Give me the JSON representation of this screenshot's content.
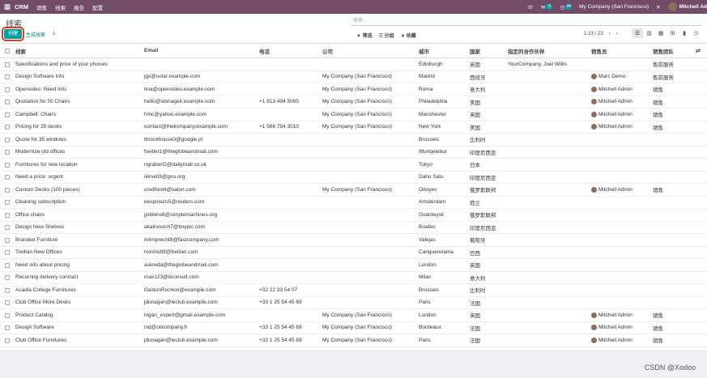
{
  "topbar": {
    "app": "CRM",
    "menus": [
      "销售",
      "线索",
      "报告",
      "配置"
    ],
    "msg_count": "5",
    "activity_count": "44",
    "company": "My Company (San Francisco)",
    "user": "Mitchell Ad"
  },
  "control": {
    "title": "线索",
    "search_placeholder": "搜索...",
    "create_label": "创建",
    "generate_label": "生成线索",
    "filter_label": "筛选",
    "group_label": "分组",
    "favorite_label": "收藏",
    "pager": "1-23 / 23"
  },
  "columns": [
    "线索",
    "Email",
    "电话",
    "公司",
    "城市",
    "国家",
    "指定的合作伙伴",
    "销售员",
    "销售团队"
  ],
  "rows": [
    [
      "Specifications and price of your phones",
      "",
      "",
      "",
      "Edinburgh",
      "英国",
      "YourCompany, Joel Willis",
      "",
      "售前服务"
    ],
    [
      "Design Software Info",
      "jgs@solar.example.com",
      "",
      "My Company (San Francisco)",
      "Madrid",
      "西班牙",
      "",
      "Marc Demo",
      "售前服务"
    ],
    [
      "Opensides: Need Info",
      "tina@opensides.example.com",
      "",
      "My Company (San Francisco)",
      "Roma",
      "意大利",
      "",
      "Mitchell Admin",
      "销售"
    ],
    [
      "Quotation for 50 Chairs",
      "hello@stonageit.example.com",
      "+1 813 494 5005",
      "My Company (San Francisco)",
      "Philadelphia",
      "美国",
      "",
      "Mitchell Admin",
      "销售"
    ],
    [
      "Campbell: Chairs",
      "hmc@yahoo.example.com",
      "",
      "My Company (San Francisco)",
      "Manchester",
      "英国",
      "",
      "Mitchell Admin",
      "销售"
    ],
    [
      "Pricing for 25 desks",
      "contact@thekompany.example.com",
      "+1 566 754 3010",
      "My Company (San Francisco)",
      "New York",
      "美国",
      "",
      "Mitchell Admin",
      "销售"
    ],
    [
      "Quote for 35 windows",
      "tbrockhouse0@google.pl",
      "",
      "",
      "Brussels",
      "比利时",
      "",
      "",
      ""
    ],
    [
      "Modernize old offices",
      "fseiller1@theglobeandmail.com",
      "",
      "",
      "Wuriqelebur",
      "印度尼西亚",
      "",
      "",
      ""
    ],
    [
      "Furnitures for new location",
      "ngrabert2@dailymail.co.uk",
      "",
      "",
      "Tokyo",
      "日本",
      "",
      "",
      ""
    ],
    [
      "Need a price: urgent",
      "ikirvell3@gnu.org",
      "",
      "",
      "Dahu Satu",
      "印度尼西亚",
      "",
      "",
      ""
    ],
    [
      "Custom Desks (100 pieces)",
      "credford4@salon.com",
      "",
      "My Company (San Francisco)",
      "Odoyev",
      "俄罗斯联邦",
      "",
      "Mitchell Admin",
      "销售"
    ],
    [
      "Cleaning subscription",
      "eespinazo5@reuters.com",
      "",
      "",
      "Amsterdam",
      "荷兰",
      "",
      "",
      ""
    ],
    [
      "Office chairs",
      "jjobbins6@simplemachines.org",
      "",
      "",
      "Gvardeysk",
      "俄罗斯联邦",
      "",
      "",
      ""
    ],
    [
      "Design New Shelves",
      "akalinovich7@tinypic.com",
      "",
      "",
      "Boafeo",
      "印度尼西亚",
      "",
      "",
      ""
    ],
    [
      "Branded Furniture",
      "mlimprecht8@fastcompany.com",
      "",
      "",
      "Valejas",
      "葡萄牙",
      "",
      "",
      ""
    ],
    [
      "Trellian New Offices",
      "roxshott9@trellian.com",
      "",
      "",
      "Cangueretama",
      "巴西",
      "",
      "",
      ""
    ],
    [
      "Need info about pricing",
      "askreda@theglobeandmail.com",
      "",
      "",
      "London",
      "英国",
      "",
      "",
      ""
    ],
    [
      "Recurring delivery contract",
      "max123@itconsult.com",
      "",
      "",
      "Milan",
      "意大利",
      "",
      "",
      ""
    ],
    [
      "Acadia College Furnitures",
      "GastonRochon@example.com",
      "+32 22 33 54 07",
      "",
      "Brussels",
      "比利时",
      "",
      "",
      ""
    ],
    [
      "Club Office More Desks",
      "jdunagan@leclub.example.com",
      "+33 1 25 54 45 69",
      "",
      "Paris",
      "法国",
      "",
      "",
      ""
    ],
    [
      "Product Catalog",
      "logan_expert@gmail.example.com",
      "",
      "My Company (San Francisco)",
      "London",
      "英国",
      "",
      "Mitchell Admin",
      "销售"
    ],
    [
      "Design Software",
      "ind@oilcompany.fr",
      "+33 1 25 54 45 69",
      "My Company (San Francisco)",
      "Bordeaux",
      "法国",
      "",
      "Mitchell Admin",
      "销售"
    ],
    [
      "Club Office Furnitures",
      "jdunagan@leclub.example.com",
      "+33 1 25 54 45 69",
      "My Company (San Francisco)",
      "Paris",
      "法国",
      "",
      "Mitchell Admin",
      "销售"
    ]
  ],
  "watermark": "CSDN @Xodoo"
}
